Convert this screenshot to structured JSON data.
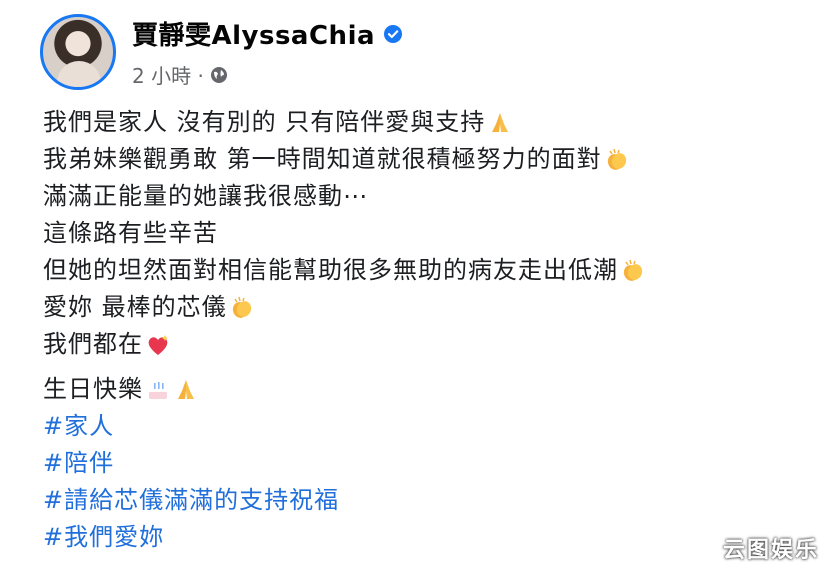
{
  "author": {
    "name": "賈靜雯AlyssaChia",
    "timestamp": "2 小時 ·"
  },
  "post": {
    "lines": [
      "我們是家人 沒有別的 只有陪伴愛與支持",
      "我弟妹樂觀勇敢 第一時間知道就很積極努力的面對",
      "滿滿正能量的她讓我很感動⋯",
      "這條路有些辛苦",
      "但她的坦然面對相信能幫助很多無助的病友走出低潮",
      "愛妳 最棒的芯儀",
      "我們都在",
      "生日快樂"
    ],
    "hashtags": [
      "#家人",
      "#陪伴",
      "#請給芯儀滿滿的支持祝福",
      "#我們愛妳"
    ]
  },
  "watermark": "云图娱乐",
  "icons": {
    "verified": "verified-badge-icon",
    "privacy": "globe-icon",
    "pray": "folded-hands-icon",
    "clap": "clapping-hands-icon",
    "heart": "sparkling-heart-icon",
    "cake": "birthday-cake-icon"
  },
  "colors": {
    "brand_blue": "#1877f2",
    "hashtag": "#216fdb",
    "meta_gray": "#65676b"
  }
}
